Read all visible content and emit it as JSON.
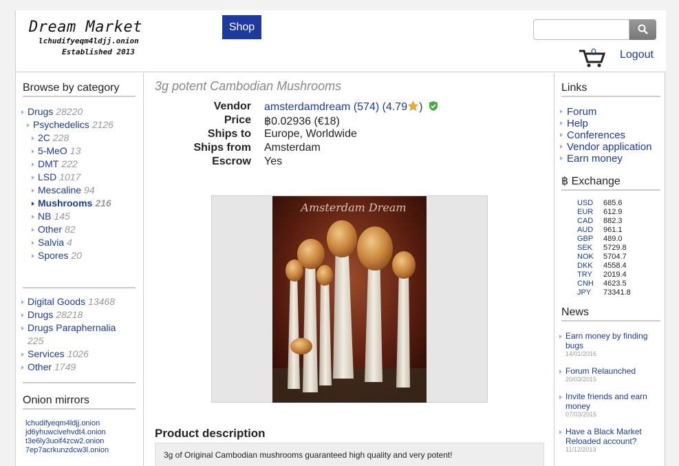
{
  "header": {
    "logo_title": "Dream Market",
    "logo_onion": "lchudifyeqm4ldjj.onion",
    "logo_established": "Established 2013",
    "shop_label": "Shop",
    "search_placeholder": "",
    "cart_count": "0",
    "logout_label": "Logout"
  },
  "sidebar": {
    "browse_title": "Browse by category",
    "categories": [
      {
        "name": "Drugs",
        "count": "28220"
      },
      {
        "name": "Psychedelics",
        "count": "2126"
      },
      {
        "name": "2C",
        "count": "228"
      },
      {
        "name": "5-MeO",
        "count": "13"
      },
      {
        "name": "DMT",
        "count": "222"
      },
      {
        "name": "LSD",
        "count": "1017"
      },
      {
        "name": "Mescaline",
        "count": "94"
      },
      {
        "name": "Mushrooms",
        "count": "216"
      },
      {
        "name": "NB",
        "count": "145"
      },
      {
        "name": "Other",
        "count": "82"
      },
      {
        "name": "Salvia",
        "count": "4"
      },
      {
        "name": "Spores",
        "count": "20"
      }
    ],
    "top_categories": [
      {
        "name": "Digital Goods",
        "count": "13468"
      },
      {
        "name": "Drugs",
        "count": "28218"
      },
      {
        "name": "Drugs Paraphernalia",
        "count": "225"
      },
      {
        "name": "Services",
        "count": "1026"
      },
      {
        "name": "Other",
        "count": "1749"
      }
    ],
    "mirrors_title": "Onion mirrors",
    "mirrors": [
      "lchudifyeqm4ldjj.onion",
      "jd6yhuwcivehvdt4.onion",
      "t3e6ly3uoif4zcw2.onion",
      "7ep7acrkunzdcw3l.onion"
    ]
  },
  "product": {
    "title": "3g potent Cambodian Mushrooms",
    "vendor_label": "Vendor",
    "vendor_name": "amsterdamdream",
    "vendor_rating": "(574) (4.79",
    "vendor_rating_close": ")",
    "price_label": "Price",
    "price_value": "฿0.02936 (€18)",
    "ships_to_label": "Ships to",
    "ships_to_value": "Europe, Worldwide",
    "ships_from_label": "Ships from",
    "ships_from_value": "Amsterdam",
    "escrow_label": "Escrow",
    "escrow_value": "Yes",
    "image_watermark": "Amsterdam Dream",
    "description_title": "Product description",
    "description_text": "3g of Original Cambodian mushrooms guaranteed high quality and very potent!"
  },
  "right": {
    "links_title": "Links",
    "links": [
      "Forum",
      "Help",
      "Conferences",
      "Vendor application",
      "Earn money"
    ],
    "exchange_title": "฿ Exchange",
    "exchange": [
      {
        "cur": "USD",
        "val": "685.6"
      },
      {
        "cur": "EUR",
        "val": "612.9"
      },
      {
        "cur": "CAD",
        "val": "882.3"
      },
      {
        "cur": "AUD",
        "val": "961.1"
      },
      {
        "cur": "GBP",
        "val": "489.0"
      },
      {
        "cur": "SEK",
        "val": "5729.8"
      },
      {
        "cur": "NOK",
        "val": "5704.7"
      },
      {
        "cur": "DKK",
        "val": "4558.4"
      },
      {
        "cur": "TRY",
        "val": "2019.4"
      },
      {
        "cur": "CNH",
        "val": "4623.5"
      },
      {
        "cur": "JPY",
        "val": "73341.8"
      }
    ],
    "news_title": "News",
    "news": [
      {
        "title": "Earn money by finding bugs",
        "date": "14/01/2016"
      },
      {
        "title": "Forum Relaunched",
        "date": "20/03/2015"
      },
      {
        "title": "Invite friends and earn money",
        "date": "07/03/2015"
      },
      {
        "title": "Have a Black Market Reloaded account?",
        "date": "11/12/2013"
      }
    ]
  },
  "colors": {
    "link": "#1a3a9c",
    "shop_button": "#1d3aa0",
    "muted": "#999999"
  }
}
